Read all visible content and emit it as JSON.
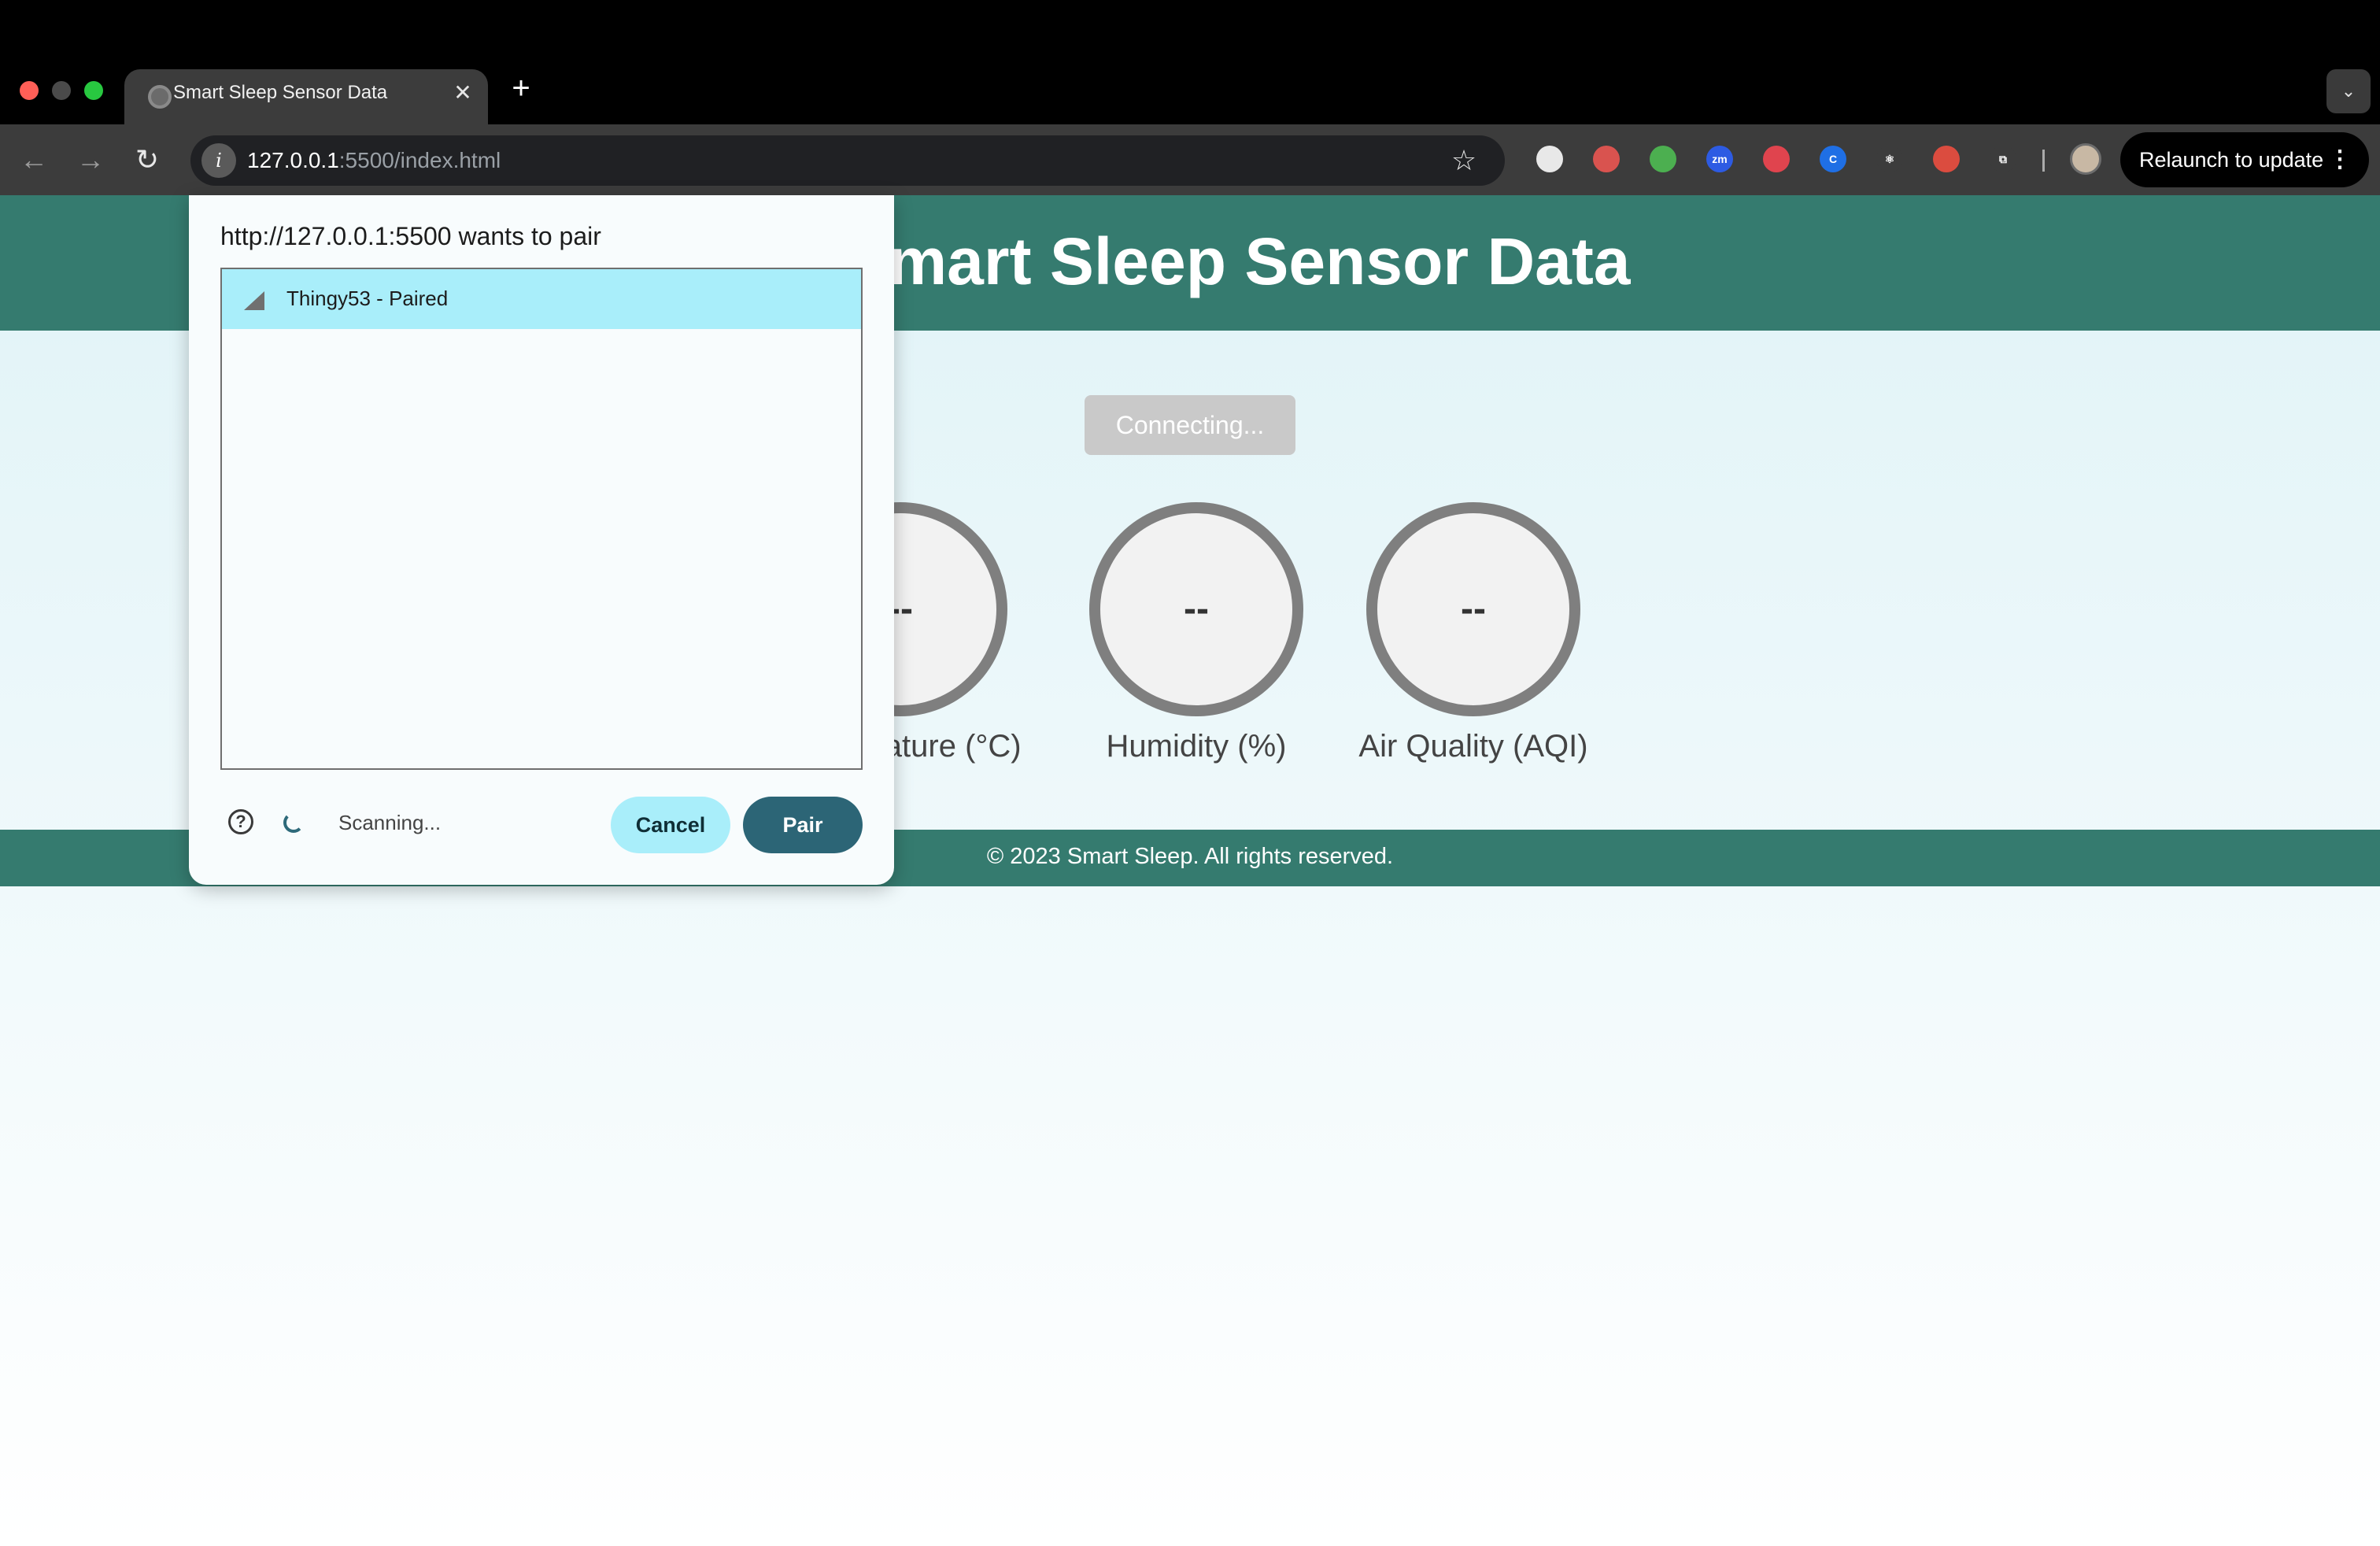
{
  "browser": {
    "tab_title": "Smart Sleep Sensor Data",
    "tab_close": "✕",
    "new_tab": "+",
    "tab_menu": "⌄",
    "url_host": "127.0.0.1",
    "url_rest": ":5500/index.html",
    "site_info_icon": "i",
    "bookmark_icon": "☆",
    "relaunch_label": "Relaunch to update",
    "relaunch_menu": "⋮",
    "back": "←",
    "forward": "→",
    "reload": "↻",
    "extensions": [
      {
        "name": "password-extension-icon",
        "text": "",
        "color": "#e8e8e8"
      },
      {
        "name": "mail-extension-icon",
        "text": "",
        "color": "#d9534f"
      },
      {
        "name": "shield-extension-icon",
        "text": "",
        "color": "#4caf50"
      },
      {
        "name": "zoom-extension-icon",
        "text": "zm",
        "color": "#2d5be3"
      },
      {
        "name": "red-extension-icon",
        "text": "",
        "color": "#e0444e"
      },
      {
        "name": "blue-c-extension-icon",
        "text": "C",
        "color": "#1f6fe5"
      },
      {
        "name": "react-extension-icon",
        "text": "⚛",
        "color": "#3c3c3c"
      },
      {
        "name": "todoist-extension-icon",
        "text": "",
        "color": "#db4c3f"
      },
      {
        "name": "puzzle-extension-icon",
        "text": "⧉",
        "color": "#3c3c3c"
      }
    ]
  },
  "page": {
    "title": "Smart Sleep Sensor Data",
    "connect_button": "Connecting...",
    "gauges": [
      {
        "value": "--",
        "label": "Temperature (°C)"
      },
      {
        "value": "--",
        "label": "Humidity (%)"
      },
      {
        "value": "--",
        "label": "Air Quality (AQI)"
      }
    ],
    "footer": "© 2023 Smart Sleep. All rights reserved."
  },
  "dialog": {
    "title": "http://127.0.0.1:5500 wants to pair",
    "devices": [
      {
        "name": "Thingy53 - Paired"
      }
    ],
    "help_icon": "?",
    "status": "Scanning...",
    "cancel_label": "Cancel",
    "pair_label": "Pair"
  },
  "colors": {
    "header_green": "#357b6f",
    "selected_row": "#a9eefa",
    "pair_button": "#2c6576"
  }
}
